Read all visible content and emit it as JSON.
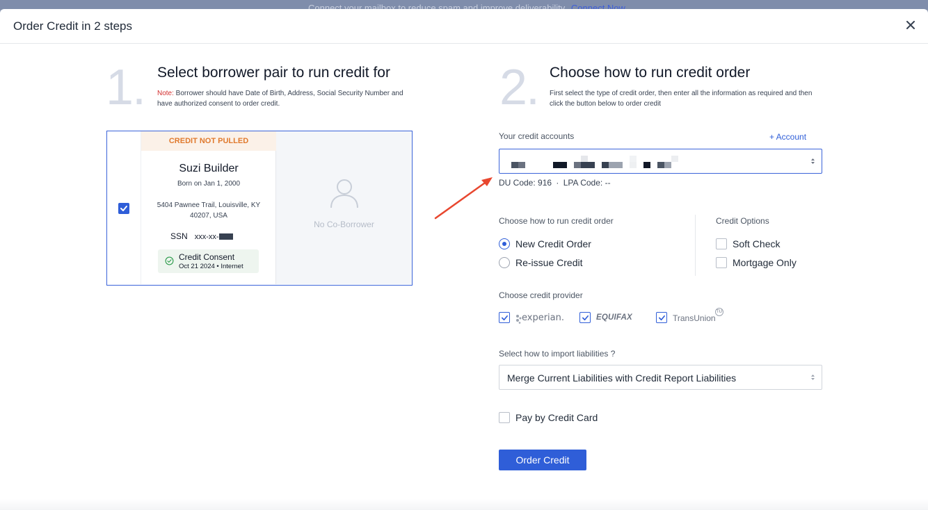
{
  "banner": {
    "text": "Connect your mailbox to reduce spam and improve deliverability.",
    "link": "Connect Now"
  },
  "modal": {
    "title": "Order Credit in 2 steps",
    "close_icon": "close-icon"
  },
  "step1": {
    "number": "1.",
    "title": "Select borrower pair to run credit for",
    "note_label": "Note:",
    "note_text": " Borrower should have Date of Birth, Address, Social Security Number and have authorized consent to order credit."
  },
  "borrower": {
    "selected": true,
    "status": "CREDIT NOT PULLED",
    "name": "Suzi Builder",
    "born": "Born on Jan 1, 2000",
    "address": "5404 Pawnee Trail, Louisville, KY 40207, USA",
    "ssn_label": "SSN",
    "ssn_value": "xxx-xx-",
    "consent_title": "Credit Consent",
    "consent_sub": "Oct 21 2024 • Internet",
    "coborrower_text": "No Co-Borrower"
  },
  "step2": {
    "number": "2.",
    "title": "Choose how to run credit order",
    "desc": "First select the type of credit order, then enter all the information as required and then click the button below to order credit"
  },
  "accounts": {
    "label": "Your credit accounts",
    "add_label": "+ Account",
    "du_label": "DU Code:",
    "du_value": "916",
    "separator": "·",
    "lpa_label": "LPA Code:",
    "lpa_value": "--"
  },
  "run_order": {
    "label": "Choose how to run credit order",
    "options": [
      {
        "label": "New Credit Order",
        "selected": true
      },
      {
        "label": "Re-issue Credit",
        "selected": false
      }
    ]
  },
  "credit_options": {
    "label": "Credit Options",
    "options": [
      {
        "label": "Soft Check",
        "checked": false
      },
      {
        "label": "Mortgage Only",
        "checked": false
      }
    ]
  },
  "providers": {
    "label": "Choose credit provider",
    "items": [
      {
        "name": "experian.",
        "checked": true
      },
      {
        "name": "EQUIFAX",
        "checked": true
      },
      {
        "name": "TransUnion",
        "checked": true
      }
    ]
  },
  "liabilities": {
    "label": "Select how to import liabilities ?",
    "value": "Merge Current Liabilities with Credit Report Liabilities"
  },
  "pay_card": {
    "label": "Pay by Credit Card",
    "checked": false
  },
  "order_button": "Order Credit",
  "colors": {
    "accent": "#2f5ed8",
    "status_orange": "#e07a2e",
    "note_red": "#d32f2f",
    "arrow_red": "#e8472f"
  }
}
